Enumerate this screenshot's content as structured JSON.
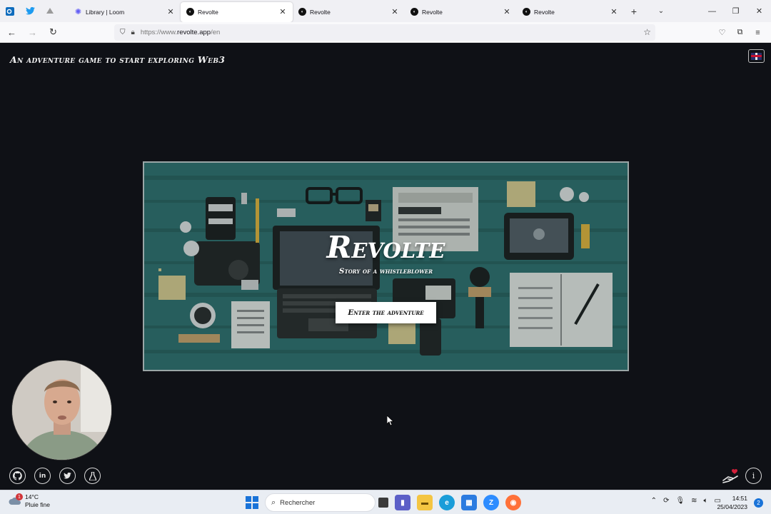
{
  "browser": {
    "pinned_tabs": [
      {
        "icon": "outlook-icon",
        "color": "#0f6cbd"
      },
      {
        "icon": "twitter-icon",
        "color": "#1d9bf0"
      },
      {
        "icon": "bird-app-icon",
        "color": "#888888"
      }
    ],
    "tabs": [
      {
        "title": "Library | Loom",
        "icon": "loom-icon",
        "active": false
      },
      {
        "title": "Revolte",
        "icon": "revolte-icon",
        "active": true
      },
      {
        "title": "Revolte",
        "icon": "revolte-icon",
        "active": false
      },
      {
        "title": "Revolte",
        "icon": "revolte-icon",
        "active": false
      },
      {
        "title": "Revolte",
        "icon": "revolte-icon",
        "active": false
      }
    ],
    "url": {
      "prefix": "https://www.",
      "host": "revolte.app",
      "path": "/en"
    }
  },
  "page": {
    "tagline": "An adventure game to start exploring Web3",
    "language_flag": "uk-flag-icon",
    "hero": {
      "title": "Revolte",
      "subtitle": "Story of a whistleblower",
      "cta_label": "Enter the adventure",
      "background_color": "#2d6b6b"
    },
    "social_icons": [
      "github-icon",
      "linkedin-icon",
      "twitter-icon",
      "flask-icon"
    ],
    "info_icon": "info-icon",
    "donate_icon": "hand-heart-icon"
  },
  "taskbar": {
    "weather": {
      "temp": "14°C",
      "desc": "Pluie fine",
      "badge": "1"
    },
    "search_placeholder": "Rechercher",
    "clock": {
      "time": "14:51",
      "date": "25/04/2023"
    },
    "notifications": "2"
  },
  "colors": {
    "page_bg": "#0f1116",
    "accent": "#ffffff"
  }
}
